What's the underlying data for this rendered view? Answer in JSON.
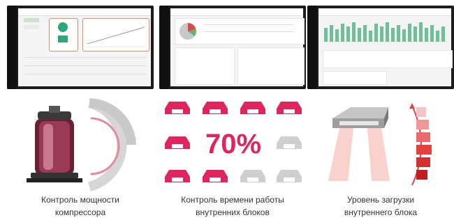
{
  "captions": [
    {
      "line1": "Контроль мощности",
      "line2": "компрессора"
    },
    {
      "line1": "Контроль времени работы",
      "line2": "внутренних блоков"
    },
    {
      "line1": "Уровень загрузки",
      "line2": "внутреннего блока"
    }
  ],
  "illustration": {
    "percent": "70%"
  },
  "colors": {
    "accent": "#e0245e",
    "orange": "#f0a070",
    "red": "#e54040",
    "gray": "#cfcfcf"
  }
}
